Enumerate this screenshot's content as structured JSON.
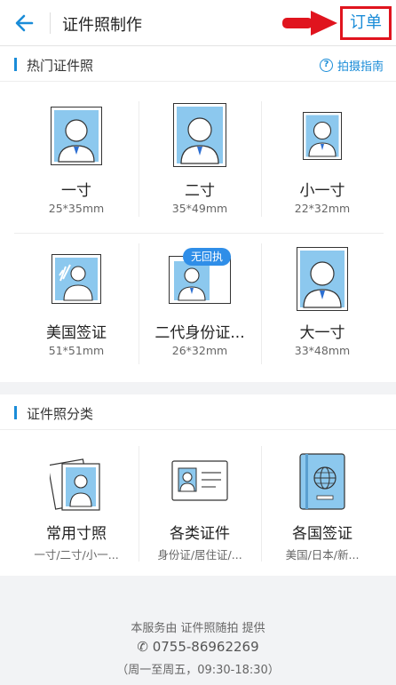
{
  "header": {
    "title": "证件照制作",
    "order_label": "订单"
  },
  "hot": {
    "section_title": "热门证件照",
    "guide_label": "拍摄指南",
    "items": [
      {
        "name": "一寸",
        "size": "25*35mm"
      },
      {
        "name": "二寸",
        "size": "35*49mm"
      },
      {
        "name": "小一寸",
        "size": "22*32mm"
      },
      {
        "name": "美国签证",
        "size": "51*51mm"
      },
      {
        "name": "二代身份证...",
        "size": "26*32mm",
        "badge": "无回执"
      },
      {
        "name": "大一寸",
        "size": "33*48mm"
      }
    ]
  },
  "categories": {
    "section_title": "证件照分类",
    "items": [
      {
        "name": "常用寸照",
        "desc": "一寸/二寸/小一..."
      },
      {
        "name": "各类证件",
        "desc": "身份证/居住证/..."
      },
      {
        "name": "各国签证",
        "desc": "美国/日本/新..."
      }
    ]
  },
  "footer": {
    "provider": "本服务由 证件照随拍 提供",
    "phone": "0755-86962269",
    "hours": "（周一至周五，09:30-18:30）"
  },
  "colors": {
    "accent": "#1a8cd8",
    "photo_bg": "#8cc8ee",
    "highlight": "#e0141e"
  }
}
